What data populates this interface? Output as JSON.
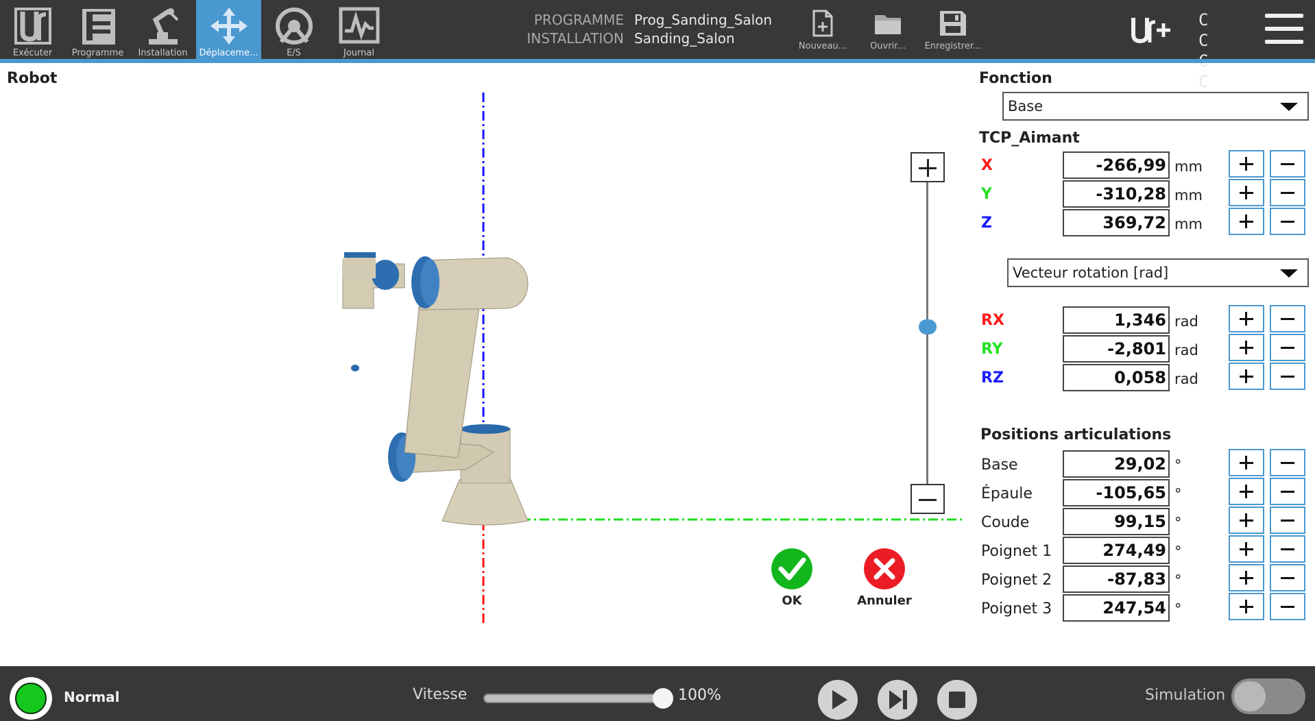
{
  "nav": [
    {
      "label": "Exécuter",
      "icon": "ur-logo-icon"
    },
    {
      "label": "Programme",
      "icon": "program-icon"
    },
    {
      "label": "Installation",
      "icon": "installation-robot-icon"
    },
    {
      "label": "Déplaceme...",
      "icon": "move-arrows-icon",
      "active": true
    },
    {
      "label": "E/S",
      "icon": "io-icon"
    },
    {
      "label": "Journal",
      "icon": "log-graph-icon"
    }
  ],
  "program": {
    "program_label": "PROGRAMME",
    "program_name": "Prog_Sanding_Salon",
    "installation_label": "INSTALLATION",
    "installation_name": "Sanding_Salon"
  },
  "file_actions": {
    "new_label": "Nouveau...",
    "open_label": "Ouvrir...",
    "save_label": "Enregistrer..."
  },
  "header_right": {
    "cc_text": "C C C C"
  },
  "robot_panel": {
    "title": "Robot"
  },
  "actions": {
    "ok_label": "OK",
    "cancel_label": "Annuler"
  },
  "feature": {
    "title": "Fonction",
    "selected": "Base"
  },
  "tcp": {
    "title": "TCP_Aimant",
    "position": [
      {
        "axis": "X",
        "value": "-266,99",
        "unit": "mm",
        "color": "#ff1a1a"
      },
      {
        "axis": "Y",
        "value": "-310,28",
        "unit": "mm",
        "color": "#22e022"
      },
      {
        "axis": "Z",
        "value": "369,72",
        "unit": "mm",
        "color": "#1a1aff"
      }
    ],
    "rotation_mode": "Vecteur rotation [rad]",
    "rotation": [
      {
        "axis": "RX",
        "value": "1,346",
        "unit": "rad",
        "color": "#ff1a1a"
      },
      {
        "axis": "RY",
        "value": "-2,801",
        "unit": "rad",
        "color": "#22e022"
      },
      {
        "axis": "RZ",
        "value": "0,058",
        "unit": "rad",
        "color": "#1a1aff"
      }
    ]
  },
  "joints": {
    "title": "Positions articulations",
    "items": [
      {
        "name": "Base",
        "value": "29,02",
        "unit": "°"
      },
      {
        "name": "Épaule",
        "value": "-105,65",
        "unit": "°"
      },
      {
        "name": "Coude",
        "value": "99,15",
        "unit": "°"
      },
      {
        "name": "Poignet 1",
        "value": "274,49",
        "unit": "°"
      },
      {
        "name": "Poignet 2",
        "value": "-87,83",
        "unit": "°"
      },
      {
        "name": "Poignet 3",
        "value": "247,54",
        "unit": "°"
      }
    ]
  },
  "footer": {
    "status": "Normal",
    "speed_label": "Vitesse",
    "speed_value": "100%",
    "speed_fraction": 1.0,
    "simulation_label": "Simulation"
  }
}
